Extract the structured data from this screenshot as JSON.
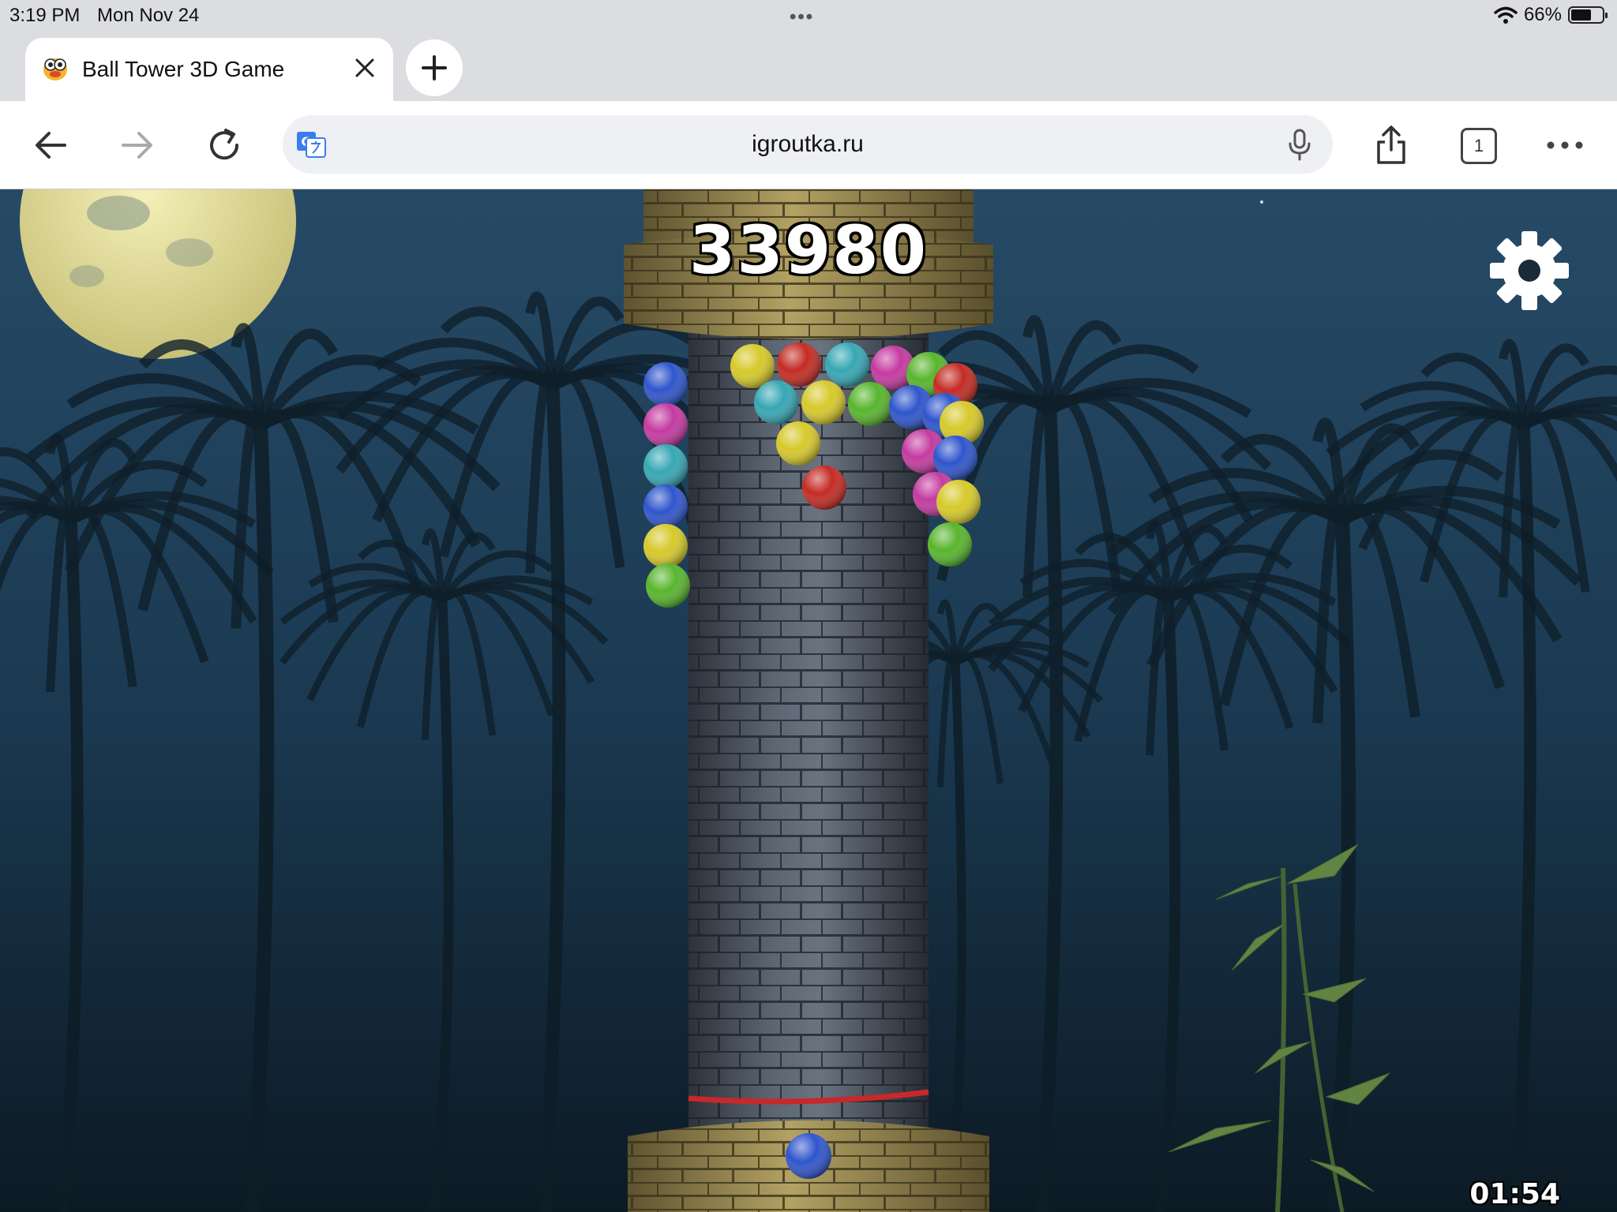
{
  "status_bar": {
    "time": "3:19 PM",
    "date": "Mon Nov 24",
    "battery_text": "66%",
    "battery_level": 0.66,
    "icons": [
      "wifi-icon",
      "battery-icon"
    ]
  },
  "browser": {
    "tab": {
      "title": "Ball Tower 3D Game",
      "favicon": "owl-favicon-icon"
    },
    "tab_count": "1",
    "url": "igroutka.ru",
    "icons": [
      "back-arrow-icon",
      "forward-arrow-icon",
      "reload-icon",
      "translate-icon",
      "microphone-icon",
      "share-icon",
      "more-icon",
      "close-icon",
      "plus-icon"
    ]
  },
  "game": {
    "score": "33980",
    "timer": "01:54",
    "icons": [
      "gear-icon"
    ],
    "colors": {
      "sky": "#1d3c55",
      "tower_stone": "#4d5663",
      "tower_cap": "#9a8a52",
      "danger_line": "#c8282a"
    },
    "balls": [
      {
        "color": "#d6c92a",
        "label": "yellow"
      },
      {
        "color": "#c42b24",
        "label": "red"
      },
      {
        "color": "#35a7b4",
        "label": "cyan"
      },
      {
        "color": "#c43aa0",
        "label": "magenta"
      },
      {
        "color": "#58b52d",
        "label": "green"
      },
      {
        "color": "#2f55cc",
        "label": "blue"
      }
    ],
    "player_ball": {
      "color": "#2f55cc",
      "label": "blue"
    }
  }
}
